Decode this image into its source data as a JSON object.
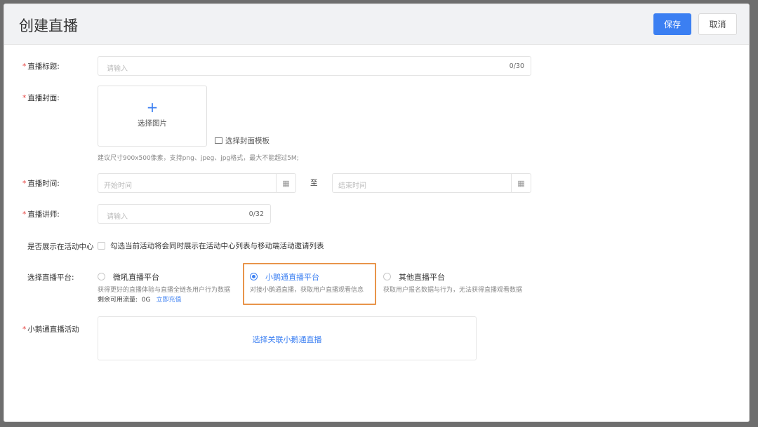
{
  "header": {
    "title": "创建直播",
    "save_label": "保存",
    "cancel_label": "取消"
  },
  "form": {
    "title": {
      "label": "直播标题:",
      "placeholder": "请输入",
      "counter": "0/30"
    },
    "cover": {
      "label": "直播封面:",
      "upload_label": "选择图片",
      "template_link": "选择封面模板",
      "hint": "建议尺寸900x500像素，支持png、jpeg、jpg格式，最大不能超过5M;"
    },
    "time": {
      "label": "直播时间:",
      "start_placeholder": "开始时间",
      "separator": "至",
      "end_placeholder": "结束时间"
    },
    "lecturer": {
      "label": "直播讲师:",
      "placeholder": "请输入",
      "counter": "0/32"
    },
    "show_in_center": {
      "label": "是否展示在活动中心",
      "checkbox_text": "勾选当前活动将会同时展示在活动中心列表与移动端活动邀请列表"
    },
    "platform": {
      "label": "选择直播平台:",
      "options": [
        {
          "title": "微吼直播平台",
          "desc": "获得更好的直播体验与直播全链条用户行为数据",
          "extra_label": "剩余可用流量:",
          "extra_value": "0G",
          "extra_link": "立即充值"
        },
        {
          "title": "小鹅通直播平台",
          "desc": "对接小鹅通直播，获取用户直播观看信息"
        },
        {
          "title": "其他直播平台",
          "desc": "获取用户报名数据与行为，无法获得直播观看数据"
        }
      ],
      "selected": "小鹅通直播平台"
    },
    "activity": {
      "label": "小鹅通直播活动",
      "link": "选择关联小鹅通直播"
    }
  },
  "colors": {
    "primary": "#3b7ff2",
    "required": "#e64340",
    "highlight": "#e8944a"
  },
  "icons": {
    "plus": "plus-icon",
    "template": "template-icon",
    "calendar": "calendar-icon"
  }
}
